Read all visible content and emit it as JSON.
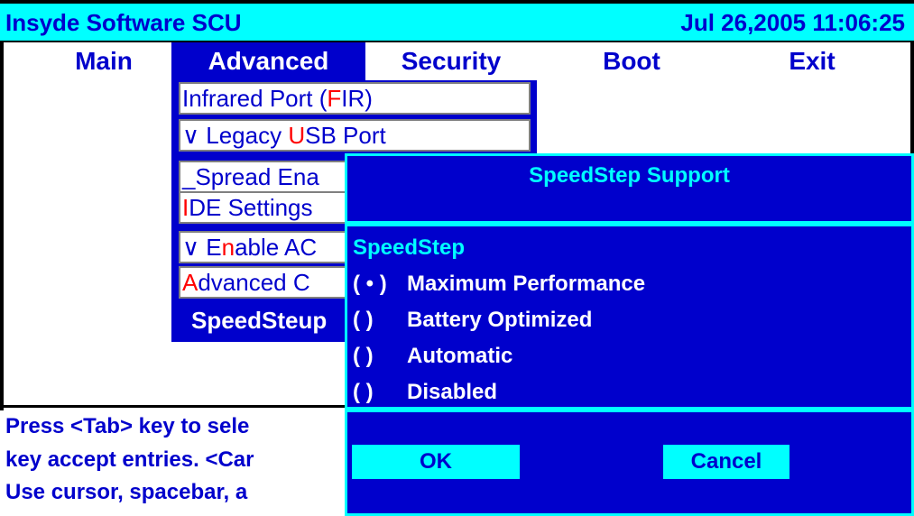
{
  "header": {
    "title": "Insyde Software SCU",
    "datetime": "Jul 26,2005 11:06:25"
  },
  "menu": [
    {
      "label": "Main"
    },
    {
      "label": "Advanced"
    },
    {
      "label": "Security"
    },
    {
      "label": "Boot"
    },
    {
      "label": "Exit"
    }
  ],
  "dropdown": {
    "items": [
      {
        "pre": "",
        "hot": "",
        "mid": "Infrared Port (",
        "hot2": "F",
        "post": "IR)"
      },
      {
        "pre": "∨ Legacy ",
        "hot": "U",
        "post": "SB Port"
      },
      {
        "pre": "_Spread Ena",
        "hot": "",
        "post": ""
      },
      {
        "pre": "",
        "hot": "I",
        "post": "DE Settings"
      },
      {
        "pre": "∨ E",
        "hot": "n",
        "post": "able AC"
      },
      {
        "pre": "",
        "hot": "A",
        "post": "dvanced C"
      },
      {
        "label": "SpeedSteup"
      }
    ]
  },
  "help": {
    "line1": "Press <Tab> key to sele",
    "line2": "key accept entries. <Car",
    "line3": "Use cursor, spacebar, a"
  },
  "dialog": {
    "title": "SpeedStep Support",
    "group_label": "SpeedStep",
    "options": [
      {
        "mark": "( • )",
        "label": "Maximum Performance",
        "selected": true
      },
      {
        "mark": "(    )",
        "label": "Battery Optimized",
        "selected": false
      },
      {
        "mark": "(    )",
        "label": "Automatic",
        "selected": false
      },
      {
        "mark": "(    )",
        "label": "Disabled",
        "selected": false
      }
    ],
    "ok_label": "OK",
    "cancel_label": "Cancel"
  },
  "colors": {
    "blue": "#0000cc",
    "cyan": "#00ffff",
    "hotkey": "#ff0000"
  }
}
